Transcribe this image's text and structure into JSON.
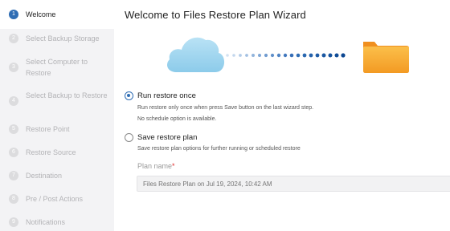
{
  "wizard": {
    "title": "Welcome to Files Restore Plan Wizard"
  },
  "sidebar": {
    "steps": [
      {
        "num": "1",
        "label": "Welcome",
        "active": true
      },
      {
        "num": "2",
        "label": "Select Backup Storage",
        "active": false
      },
      {
        "num": "3",
        "label": "Select Computer to Restore",
        "active": false
      },
      {
        "num": "4",
        "label": "Select Backup to Restore",
        "active": false
      },
      {
        "num": "5",
        "label": "Restore Point",
        "active": false
      },
      {
        "num": "6",
        "label": "Restore Source",
        "active": false
      },
      {
        "num": "7",
        "label": "Destination",
        "active": false
      },
      {
        "num": "8",
        "label": "Pre / Post Actions",
        "active": false
      },
      {
        "num": "9",
        "label": "Notifications",
        "active": false
      }
    ]
  },
  "illustration": {
    "source_icon": "cloud-icon",
    "target_icon": "folder-icon",
    "colors": {
      "cloud": "#9bd3ee",
      "folder": "#f7a531",
      "dots": "#2f6db4"
    }
  },
  "options": {
    "run_once": {
      "label": "Run restore once",
      "desc1": "Run restore only once when press Save button on the last wizard step.",
      "desc2": "No schedule option is available.",
      "checked": true
    },
    "save_plan": {
      "label": "Save restore plan",
      "desc": "Save restore plan options for further running or scheduled restore",
      "checked": false
    }
  },
  "plan_name": {
    "label": "Plan name",
    "required_mark": "*",
    "placeholder": "Files Restore Plan on Jul 19, 2024, 10:42 AM"
  },
  "colors": {
    "accent": "#2f6db4",
    "sidebar_bg": "#f3f3f5"
  }
}
